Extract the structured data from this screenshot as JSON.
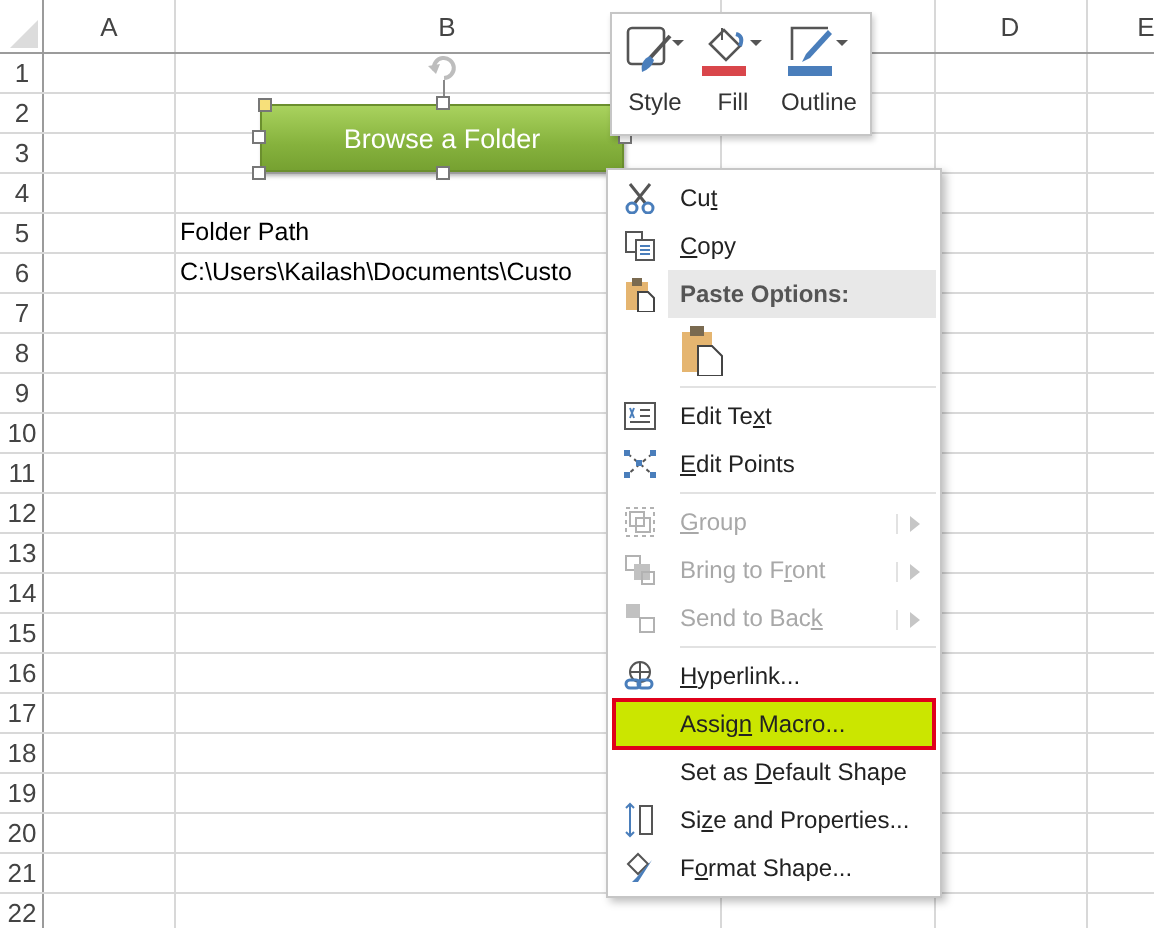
{
  "sheet": {
    "columns": [
      {
        "label": "A"
      },
      {
        "label": "B"
      },
      {},
      {
        "label": "D"
      },
      {
        "label": "E"
      }
    ],
    "rows": [
      {
        "header": "1"
      },
      {
        "header": "2"
      },
      {
        "header": "3"
      },
      {
        "header": "4"
      },
      {
        "header": "5",
        "cells": [
          null,
          "Folder Path"
        ]
      },
      {
        "header": "6",
        "cells": [
          null,
          "C:\\Users\\Kailash\\Documents\\Custo"
        ]
      },
      {
        "header": "7"
      },
      {
        "header": "8"
      },
      {
        "header": "9"
      },
      {
        "header": "10"
      },
      {
        "header": "11"
      },
      {
        "header": "12"
      },
      {
        "header": "13"
      },
      {
        "header": "14"
      },
      {
        "header": "15"
      },
      {
        "header": "16"
      },
      {
        "header": "17"
      },
      {
        "header": "18"
      },
      {
        "header": "19"
      },
      {
        "header": "20"
      },
      {
        "header": "21"
      },
      {
        "header": "22"
      }
    ]
  },
  "shape": {
    "label": "Browse a Folder",
    "selected": true
  },
  "mini_toolbar": [
    {
      "label": "Style"
    },
    {
      "label": "Fill",
      "color": "#d9464b"
    },
    {
      "label": "Outline",
      "color": "#4a7ebb"
    }
  ],
  "context_menu": [
    {
      "kind": "item",
      "after": "Cu",
      "key": "t",
      "disabled": false,
      "selected": false
    },
    {
      "kind": "item",
      "key": "C",
      "tail": "opy",
      "disabled": false,
      "selected": false
    },
    {
      "kind": "header",
      "tail": "Paste Options:"
    },
    {
      "kind": "paste"
    },
    {
      "kind": "separator"
    },
    {
      "kind": "item",
      "after": "Edit Te",
      "key": "x",
      "tail": "t",
      "disabled": false,
      "selected": false
    },
    {
      "kind": "item",
      "key": "E",
      "tail": "dit Points",
      "disabled": false,
      "selected": false
    },
    {
      "kind": "separator"
    },
    {
      "kind": "item",
      "key": "G",
      "tail": "roup",
      "disabled": true,
      "submenu": true,
      "selected": false
    },
    {
      "kind": "item",
      "after": "Bring to F",
      "key": "r",
      "tail": "ont",
      "disabled": true,
      "submenu": true,
      "selected": false
    },
    {
      "kind": "item",
      "after": "Send to Bac",
      "key": "k",
      "disabled": true,
      "submenu": true,
      "selected": false
    },
    {
      "kind": "separator"
    },
    {
      "kind": "item",
      "key": "H",
      "tail": "yperlink...",
      "disabled": false,
      "selected": false
    },
    {
      "kind": "item",
      "after": "Assig",
      "key": "n",
      "tail": " Macro...",
      "disabled": false,
      "selected": true
    },
    {
      "kind": "item",
      "after": "Set as ",
      "key": "D",
      "tail": "efault Shape",
      "disabled": false,
      "selected": false
    },
    {
      "kind": "item",
      "after": "Si",
      "key": "z",
      "tail": "e and Properties...",
      "disabled": false,
      "selected": false
    },
    {
      "kind": "item",
      "after": "F",
      "key": "o",
      "tail": "rmat Shape...",
      "disabled": false,
      "selected": false
    }
  ]
}
